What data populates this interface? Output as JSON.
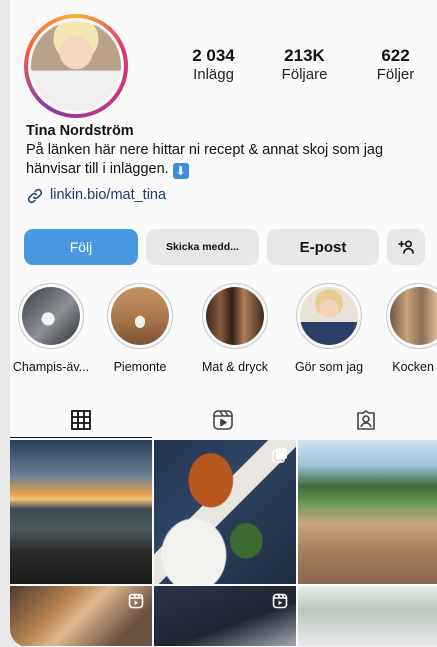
{
  "profile": {
    "stats": [
      {
        "value": "2 034",
        "label": "Inlägg"
      },
      {
        "value": "213K",
        "label": "Följare"
      },
      {
        "value": "622",
        "label": "Följer"
      }
    ],
    "name": "Tina Nordström",
    "bio": "På länken här nere hittar ni recept & annat skoj som jag hänvisar till i inläggen.",
    "bio_emoji": "⬇",
    "link": "linkin.bio/mat_tina"
  },
  "buttons": {
    "follow": "Följ",
    "message": "Skicka medd...",
    "email": "E-post",
    "add_user": "+ፆ"
  },
  "highlights": [
    {
      "label": "Champis-äv...",
      "color": "#3a3f4a"
    },
    {
      "label": "Piemonte",
      "color": "#b9865a"
    },
    {
      "label": "Mat & dryck",
      "color": "#5a4032"
    },
    {
      "label": "Gör som jag",
      "color": "#e2d3c0"
    },
    {
      "label": "Kocken &",
      "color": "#6b5a48"
    }
  ],
  "tabs": [
    {
      "name": "grid-icon",
      "active": true
    },
    {
      "name": "reels-icon",
      "active": false
    },
    {
      "name": "tagged-icon",
      "active": false
    }
  ]
}
